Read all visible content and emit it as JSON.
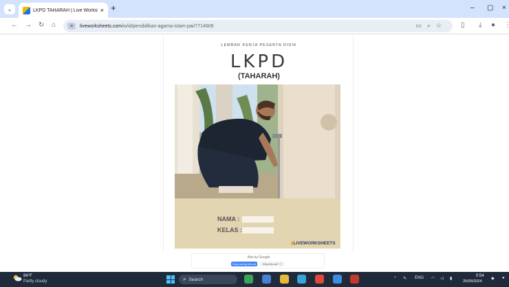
{
  "browser": {
    "tab": {
      "title": "LKPD TAHARAH | Live Workshe",
      "close": "×"
    },
    "new_tab": "+",
    "window_controls": {
      "minimize": "–",
      "maximize": "▢",
      "close": "×"
    },
    "url": {
      "host": "liveworksheets.com",
      "path": "/w/id/pendidikan-agama-islam-pai/7714609"
    }
  },
  "worksheet": {
    "subtitle": "LEMBAR KERJA PESERTA DIDIK",
    "title": "LKPD",
    "topic": "(TAHARAH)",
    "fields": [
      {
        "label": "NAMA :"
      },
      {
        "label": "KELAS :"
      }
    ],
    "brand": "LIVEWORKSHEETS"
  },
  "ad": {
    "label": "Ads by Google",
    "stop_label": "Stop seeing this ad",
    "why_label": "Why this ad? ⓘ"
  },
  "taskbar": {
    "weather": {
      "temp": "84°F",
      "desc": "Partly cloudy"
    },
    "search_label": "Search",
    "tray": {
      "language": "ENG"
    },
    "clock": {
      "time": "0:54",
      "date": "25/05/2024"
    }
  },
  "colors": {
    "tabbar": "#d3e3fd",
    "taskbar": "#1f2a3b",
    "beige": "#e2d5b1",
    "brand": "#2d3b5c"
  }
}
